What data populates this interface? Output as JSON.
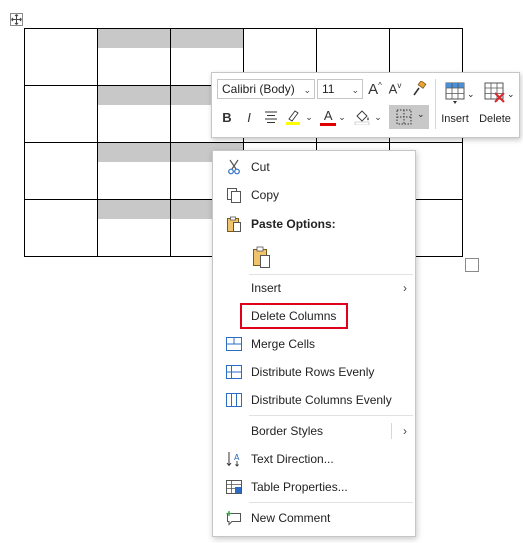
{
  "table": {
    "rows": 4,
    "columns": 6,
    "selected_columns": [
      2,
      3
    ],
    "selection_color": "#c8c8c8"
  },
  "mini_toolbar": {
    "font_name": "Calibri (Body)",
    "font_size": "11",
    "insert_label": "Insert",
    "delete_label": "Delete",
    "bold_label": "B",
    "italic_label": "I",
    "grow_font_label": "A",
    "shrink_font_label": "A",
    "font_color_label": "A",
    "highlight_color": "#ffff00",
    "font_color": "#e00000"
  },
  "context_menu": {
    "cut": "Cut",
    "copy": "Copy",
    "paste_options": "Paste Options:",
    "insert": "Insert",
    "delete_columns": "Delete Columns",
    "merge_cells": "Merge Cells",
    "distribute_rows": "Distribute Rows Evenly",
    "distribute_columns": "Distribute Columns Evenly",
    "border_styles": "Border Styles",
    "text_direction": "Text Direction...",
    "table_properties": "Table Properties...",
    "new_comment": "New Comment",
    "submenu_arrow": "›",
    "highlight_color": "#e0001b"
  }
}
